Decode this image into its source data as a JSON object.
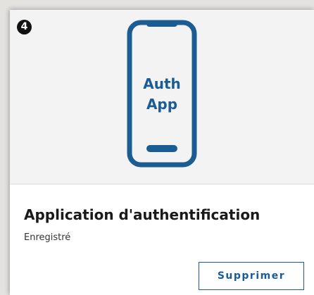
{
  "step": {
    "number": "4"
  },
  "illustration": {
    "icon": "phone-icon",
    "line1": "Auth",
    "line2": "App",
    "color": "#1b5c93"
  },
  "method": {
    "title": "Application d'authentification",
    "status": "Enregistré"
  },
  "actions": {
    "remove_label": "Supprimer"
  },
  "colors": {
    "accent": "#1b5c93",
    "step_badge": "#111111",
    "illustration_bg": "#f3f3f3"
  }
}
